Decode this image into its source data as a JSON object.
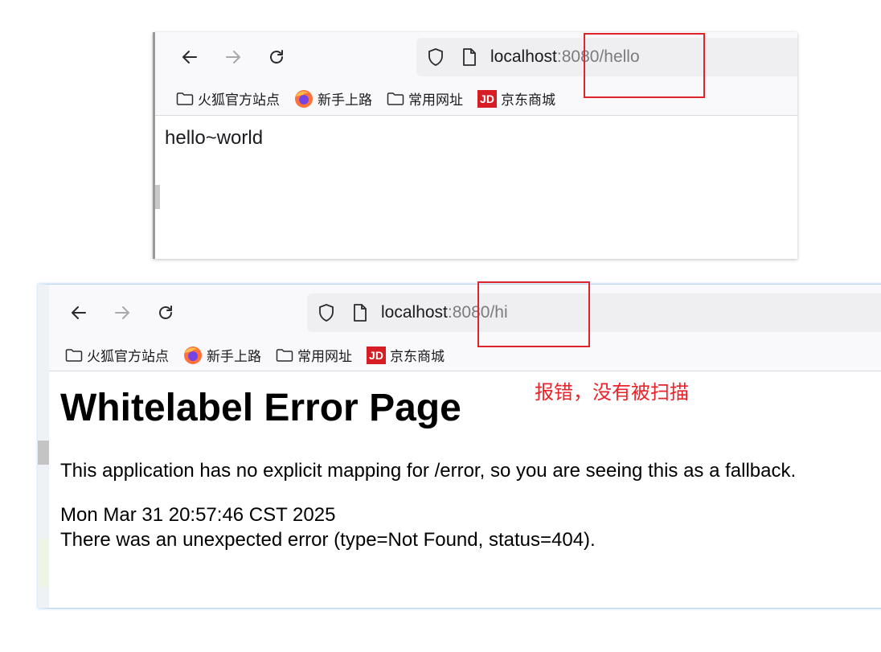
{
  "bookmarks": {
    "folder1": "火狐官方站点",
    "firefox": "新手上路",
    "folder2": "常用网址",
    "jd_logo": "JD",
    "jd": "京东商城"
  },
  "window1": {
    "url_host": "localhost",
    "url_rest": ":8080/hello",
    "content": "hello~world"
  },
  "window2": {
    "url_host": "localhost",
    "url_rest": ":8080/hi",
    "title": "Whitelabel Error Page",
    "message": "This application has no explicit mapping for /error, so you are seeing this as a fallback.",
    "timestamp": "Mon Mar 31 20:57:46 CST 2025",
    "error": "There was an unexpected error (type=Not Found, status=404)."
  },
  "annotation": "报错，没有被扫描",
  "colors": {
    "highlight_red": "#e0242b",
    "annotation_red": "#e8232a"
  },
  "icons": [
    "back-arrow-icon",
    "forward-arrow-icon",
    "reload-icon",
    "shield-icon",
    "page-icon",
    "folder-icon",
    "firefox-icon",
    "jd-logo-icon"
  ]
}
